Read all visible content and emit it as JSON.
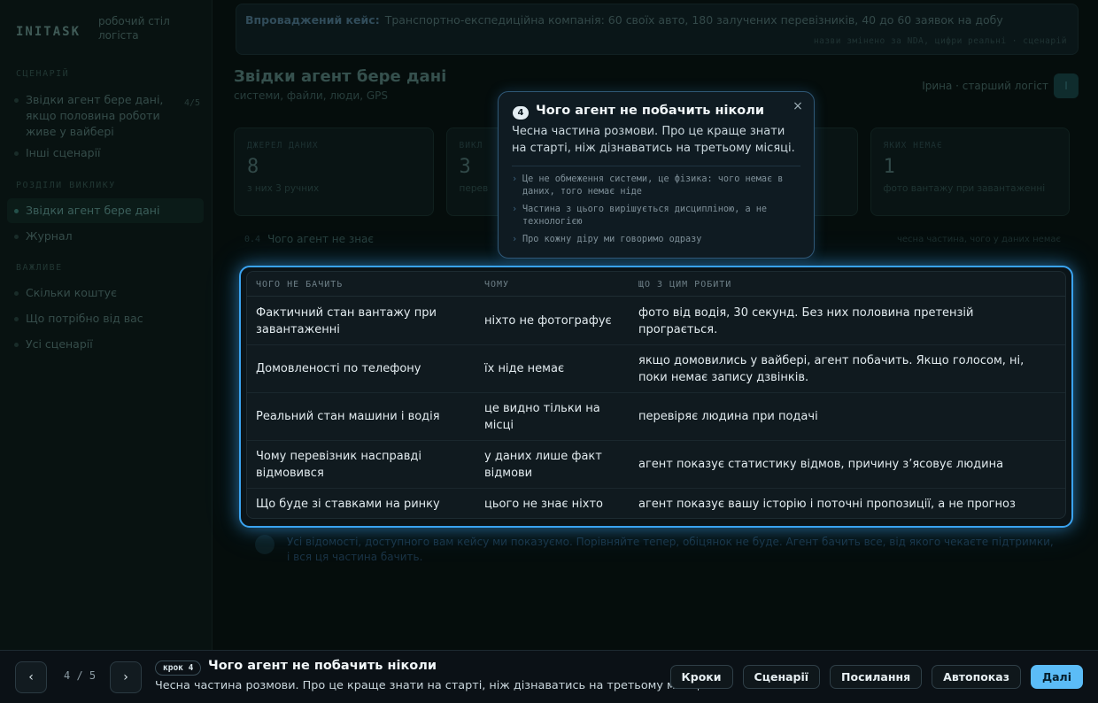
{
  "sidebar": {
    "logo": "INITASK",
    "subtitle": "робочий стіл логіста",
    "sections": [
      "СЦЕНАРІЙ",
      "РОЗДІЛИ ВИКЛИКУ",
      "ВАЖЛИВЕ"
    ],
    "scenario_items": [
      {
        "label": "Звідки агент бере дані, якщо половина роботи живе у вайбері",
        "count": "4/5"
      },
      {
        "label": "Інші сценарії",
        "count": ""
      }
    ],
    "call_items": [
      {
        "label": "Звідки агент бере дані"
      },
      {
        "label": "Журнал"
      }
    ],
    "important_items": [
      {
        "label": "Скільки коштує"
      },
      {
        "label": "Що потрібно від вас"
      },
      {
        "label": "Усі сценарії"
      }
    ]
  },
  "main": {
    "banner_label": "Впроваджений кейс:",
    "banner_text": "Транспортно-експедиційна компанія: 60 своїх авто, 180 залучених перевізників, 40 до 60 заявок на добу",
    "banner_meta": "назви змінено за NDA, цифри реальні · сценарій",
    "title": "Звідки агент бере дані",
    "subtitle": "системи, файли, люди, GPS",
    "role": "Ірина · старший логіст",
    "role_badge": "І",
    "cards": [
      {
        "label": "ДЖЕРЕЛ ДАНИХ",
        "value": "8",
        "sub": "з них 3 ручних"
      },
      {
        "label": "ВИКЛ",
        "value": "3",
        "sub": "перев"
      },
      {
        "label": "",
        "value": "",
        "sub": ""
      },
      {
        "label": "ЯКИХ НЕМАЄ",
        "value": "1",
        "sub": "фото вантажу при завантаженні"
      }
    ],
    "section_num": "0.4",
    "section_name": "Чого агент не знає",
    "section_right": "чесна частина, чого у даних немає",
    "footnote": "Усі відомості, доступного вам кейсу ми показуємо. Порівняйте тепер, обіцянок не буде. Агент бачить все, від якого чекаєте підтримки, і вся ця частина бачить."
  },
  "table": {
    "headers": [
      "ЧОГО НЕ БАЧИТЬ",
      "ЧОМУ",
      "ЩО З ЦИМ РОБИТИ"
    ],
    "rows": [
      [
        "Фактичний стан вантажу при завантаженні",
        "ніхто не фотографує",
        "фото від водія, 30 секунд. Без них половина претензій програється."
      ],
      [
        "Домовленості по телефону",
        "їх ніде немає",
        "якщо домовились у вайбері, агент побачить. Якщо голосом, ні, поки немає запису дзвінків."
      ],
      [
        "Реальний стан машини і водія",
        "це видно тільки на місці",
        "перевіряє людина при подачі"
      ],
      [
        "Чому перевізник насправді відмовився",
        "у даних лише факт відмови",
        "агент показує статистику відмов, причину з’ясовує людина"
      ],
      [
        "Що буде зі ставками на ринку",
        "цього не знає ніхто",
        "агент показує вашу історію і поточні пропозиції, а не прогноз"
      ]
    ]
  },
  "popover": {
    "step": "4",
    "title": "Чого агент не побачить ніколи",
    "body": "Чесна частина розмови. Про це краще знати на старті, ніж дізнаватись на третьому місяці.",
    "bullets": [
      "Це не обмеження системи, це фізика: чого немає в даних, того немає ніде",
      "Частина з цього вирішується дисципліною, а не технологією",
      "Про кожну діру ми говоримо одразу"
    ],
    "close": "×"
  },
  "bottombar": {
    "prev": "‹",
    "next": "›",
    "pager": "4 / 5",
    "step_chip": "крок 4",
    "title": "Чого агент не побачить ніколи",
    "desc": "Чесна частина розмови. Про це краще знати на старті, ніж дізнаватись на третьому місяці.",
    "buttons": [
      "Кроки",
      "Сценарії",
      "Посилання",
      "Автопоказ",
      "Далі"
    ]
  },
  "colors": {
    "accent": "#5bbcf7",
    "highlight_ring": "#3aa3f0",
    "background": "#07100f"
  }
}
